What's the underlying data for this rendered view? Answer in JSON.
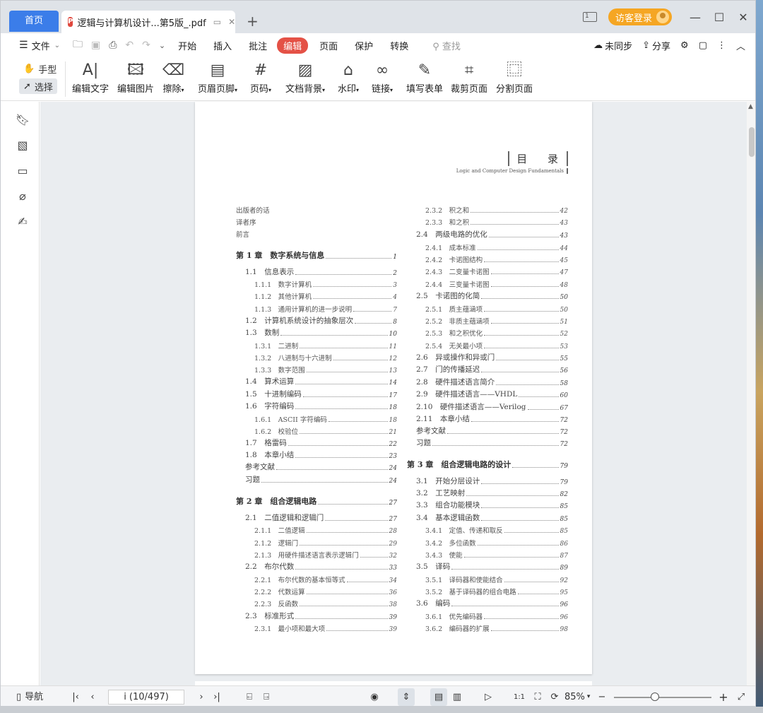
{
  "tabs": {
    "home": "首页",
    "doc": "逻辑与计算机设计...第5版_.pdf",
    "add": "+"
  },
  "titlebar": {
    "layout_num": "1",
    "login": "访客登录",
    "minimize": "—",
    "maximize": "☐",
    "close": "✕"
  },
  "menu": {
    "file": "文件",
    "items": [
      "开始",
      "插入",
      "批注",
      "编辑",
      "页面",
      "保护",
      "转换"
    ],
    "active": "编辑",
    "search_placeholder": "查找",
    "sync": "未同步",
    "share": "分享"
  },
  "ribbon": {
    "hand": "手型",
    "select": "选择",
    "tools": [
      "编辑文字",
      "编辑图片",
      "擦除",
      "页眉页脚",
      "页码",
      "文档背景",
      "水印",
      "链接",
      "填写表单",
      "裁剪页面",
      "分割页面"
    ]
  },
  "toc": {
    "title": "目 录",
    "subtitle": "Logic and Computer Design Fundamentals",
    "left": [
      {
        "t": "出版者的话",
        "p": "",
        "k": "fm"
      },
      {
        "t": "译者序",
        "p": "",
        "k": "fm"
      },
      {
        "t": "前言",
        "p": "",
        "k": "fm"
      },
      {
        "t": "第 1 章　数字系统与信息",
        "p": "1",
        "k": "ch"
      },
      {
        "t": "1.1　信息表示",
        "p": "2",
        "k": "sec"
      },
      {
        "t": "1.1.1　数字计算机",
        "p": "3",
        "k": "sub"
      },
      {
        "t": "1.1.2　其他计算机",
        "p": "4",
        "k": "sub"
      },
      {
        "t": "1.1.3　通用计算机的进一步说明",
        "p": "7",
        "k": "sub"
      },
      {
        "t": "1.2　计算机系统设计的抽象层次",
        "p": "8",
        "k": "sec"
      },
      {
        "t": "1.3　数制",
        "p": "10",
        "k": "sec"
      },
      {
        "t": "1.3.1　二进制",
        "p": "11",
        "k": "sub"
      },
      {
        "t": "1.3.2　八进制与十六进制",
        "p": "12",
        "k": "sub"
      },
      {
        "t": "1.3.3　数字范围",
        "p": "13",
        "k": "sub"
      },
      {
        "t": "1.4　算术运算",
        "p": "14",
        "k": "sec"
      },
      {
        "t": "1.5　十进制编码",
        "p": "17",
        "k": "sec"
      },
      {
        "t": "1.6　字符编码",
        "p": "18",
        "k": "sec"
      },
      {
        "t": "1.6.1　ASCII 字符编码",
        "p": "18",
        "k": "sub"
      },
      {
        "t": "1.6.2　校验位",
        "p": "21",
        "k": "sub"
      },
      {
        "t": "1.7　格雷码",
        "p": "22",
        "k": "sec"
      },
      {
        "t": "1.8　本章小结",
        "p": "23",
        "k": "sec"
      },
      {
        "t": "参考文献",
        "p": "24",
        "k": "sec"
      },
      {
        "t": "习题",
        "p": "24",
        "k": "sec"
      },
      {
        "t": "第 2 章　组合逻辑电路",
        "p": "27",
        "k": "ch"
      },
      {
        "t": "2.1　二值逻辑和逻辑门",
        "p": "27",
        "k": "sec"
      },
      {
        "t": "2.1.1　二值逻辑",
        "p": "28",
        "k": "sub"
      },
      {
        "t": "2.1.2　逻辑门",
        "p": "29",
        "k": "sub"
      },
      {
        "t": "2.1.3　用硬件描述语言表示逻辑门",
        "p": "32",
        "k": "sub"
      },
      {
        "t": "2.2　布尔代数",
        "p": "33",
        "k": "sec"
      },
      {
        "t": "2.2.1　布尔代数的基本恒等式",
        "p": "34",
        "k": "sub"
      },
      {
        "t": "2.2.2　代数运算",
        "p": "36",
        "k": "sub"
      },
      {
        "t": "2.2.3　反函数",
        "p": "38",
        "k": "sub"
      },
      {
        "t": "2.3　标准形式",
        "p": "39",
        "k": "sec"
      },
      {
        "t": "2.3.1　最小项和最大项",
        "p": "39",
        "k": "sub"
      }
    ],
    "right": [
      {
        "t": "2.3.2　积之和",
        "p": "42",
        "k": "sub"
      },
      {
        "t": "2.3.3　和之积",
        "p": "43",
        "k": "sub"
      },
      {
        "t": "2.4　两级电路的优化",
        "p": "43",
        "k": "sec"
      },
      {
        "t": "2.4.1　成本标准",
        "p": "44",
        "k": "sub"
      },
      {
        "t": "2.4.2　卡诺图结构",
        "p": "45",
        "k": "sub"
      },
      {
        "t": "2.4.3　二变量卡诺图",
        "p": "47",
        "k": "sub"
      },
      {
        "t": "2.4.4　三变量卡诺图",
        "p": "48",
        "k": "sub"
      },
      {
        "t": "2.5　卡诺图的化简",
        "p": "50",
        "k": "sec"
      },
      {
        "t": "2.5.1　质主蕴涵项",
        "p": "50",
        "k": "sub"
      },
      {
        "t": "2.5.2　非质主蕴涵项",
        "p": "51",
        "k": "sub"
      },
      {
        "t": "2.5.3　和之积优化",
        "p": "52",
        "k": "sub"
      },
      {
        "t": "2.5.4　无关最小项",
        "p": "53",
        "k": "sub"
      },
      {
        "t": "2.6　异或操作和异或门",
        "p": "55",
        "k": "sec"
      },
      {
        "t": "2.7　门的传播延迟",
        "p": "56",
        "k": "sec"
      },
      {
        "t": "2.8　硬件描述语言简介",
        "p": "58",
        "k": "sec"
      },
      {
        "t": "2.9　硬件描述语言——VHDL",
        "p": "60",
        "k": "sec"
      },
      {
        "t": "2.10　硬件描述语言——Verilog",
        "p": "67",
        "k": "sec"
      },
      {
        "t": "2.11　本章小结",
        "p": "72",
        "k": "sec"
      },
      {
        "t": "参考文献",
        "p": "72",
        "k": "sec"
      },
      {
        "t": "习题",
        "p": "72",
        "k": "sec"
      },
      {
        "t": "第 3 章　组合逻辑电路的设计",
        "p": "79",
        "k": "ch"
      },
      {
        "t": "3.1　开始分层设计",
        "p": "79",
        "k": "sec"
      },
      {
        "t": "3.2　工艺映射",
        "p": "82",
        "k": "sec"
      },
      {
        "t": "3.3　组合功能模块",
        "p": "85",
        "k": "sec"
      },
      {
        "t": "3.4　基本逻辑函数",
        "p": "85",
        "k": "sec"
      },
      {
        "t": "3.4.1　定值、传递和取反",
        "p": "85",
        "k": "sub"
      },
      {
        "t": "3.4.2　多位函数",
        "p": "86",
        "k": "sub"
      },
      {
        "t": "3.4.3　使能",
        "p": "87",
        "k": "sub"
      },
      {
        "t": "3.5　译码",
        "p": "89",
        "k": "sec"
      },
      {
        "t": "3.5.1　译码器和使能结合",
        "p": "92",
        "k": "sub"
      },
      {
        "t": "3.5.2　基于译码器的组合电路",
        "p": "95",
        "k": "sub"
      },
      {
        "t": "3.6　编码",
        "p": "96",
        "k": "sec"
      },
      {
        "t": "3.6.1　优先编码器",
        "p": "96",
        "k": "sub"
      },
      {
        "t": "3.6.2　编码器的扩展",
        "p": "98",
        "k": "sub"
      }
    ]
  },
  "status": {
    "nav": "导航",
    "page": "i (10/497)",
    "zoom": "85%"
  },
  "colors": {
    "accent": "#3b7de9",
    "active_menu": "#e45146",
    "login": "#f5a623"
  }
}
